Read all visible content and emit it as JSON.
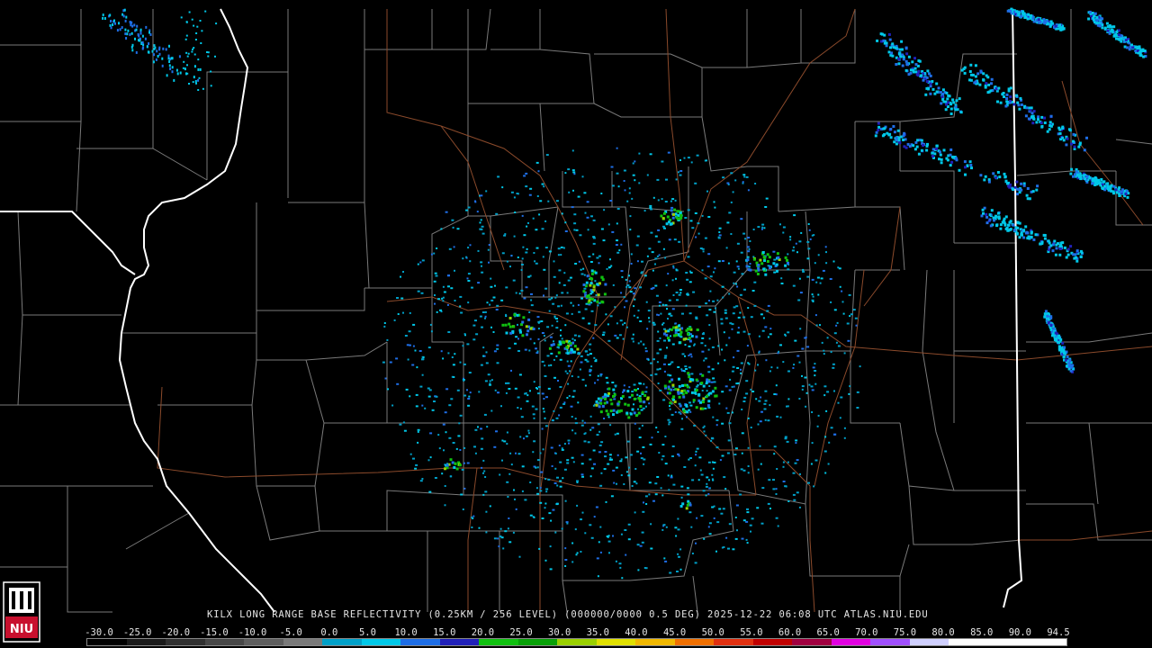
{
  "caption": "KILX LONG RANGE BASE REFLECTIVITY (0.25KM / 256 LEVEL) (000000/0000 0.5 DEG) 2025-12-22 06:08 UTC  ATLAS.NIU.EDU",
  "logo": {
    "text": "NIU",
    "color": "#c8102e"
  },
  "colors": {
    "background": "#000000",
    "county_lines": "#7a7a7a",
    "state_lines": "#ffffff",
    "highways": "#8b4a2b"
  },
  "scale": {
    "labels": [
      "-30.0",
      "-25.0",
      "-20.0",
      "-15.0",
      "-10.0",
      "-5.0",
      "0.0",
      "5.0",
      "10.0",
      "15.0",
      "20.0",
      "25.0",
      "30.0",
      "35.0",
      "40.0",
      "45.0",
      "50.0",
      "55.0",
      "60.0",
      "65.0",
      "70.0",
      "75.0",
      "80.0",
      "85.0",
      "90.0",
      "94.5"
    ],
    "colors": [
      "#000000",
      "#1a1a1a",
      "#303030",
      "#474747",
      "#5e5e5e",
      "#7a7a7a",
      "#00a0c8",
      "#00c8e8",
      "#1e6ee6",
      "#2020b8",
      "#10c010",
      "#08a008",
      "#9ad000",
      "#e0e000",
      "#f0b800",
      "#f07000",
      "#e03010",
      "#c00000",
      "#a00040",
      "#e000e0",
      "#a050ff",
      "#d0d0ff",
      "#ffffff",
      "#ffffff",
      "#ffffff"
    ]
  }
}
